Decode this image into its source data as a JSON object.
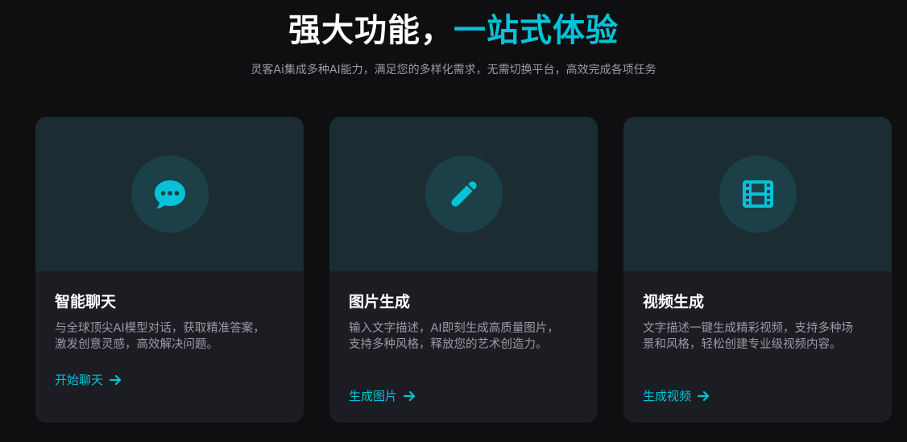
{
  "header": {
    "title_main": "强大功能，",
    "title_accent": "一站式体验",
    "subtitle": "灵客Ai集成多种AI能力，满足您的多样化需求，无需切换平台，高效完成各项任务"
  },
  "colors": {
    "accent": "#06c2d6",
    "background": "#0f0f11",
    "card": "#1c1d22",
    "card_top": "#1c2c33"
  },
  "features": [
    {
      "icon": "chat-bubble-icon",
      "title": "智能聊天",
      "description": "与全球顶尖AI模型对话，获取精准答案，激发创意灵感，高效解决问题。",
      "link": "开始聊天"
    },
    {
      "icon": "pen-icon",
      "title": "图片生成",
      "description": "输入文字描述，AI即刻生成高质量图片，支持多种风格，释放您的艺术创造力。",
      "link": "生成图片"
    },
    {
      "icon": "film-icon",
      "title": "视频生成",
      "description": "文字描述一键生成精彩视频，支持多种场景和风格，轻松创建专业级视频内容。",
      "link": "生成视频"
    }
  ]
}
